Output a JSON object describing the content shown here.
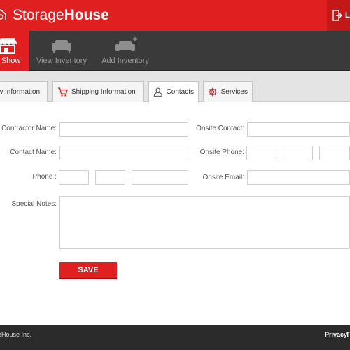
{
  "brand": {
    "name_light": "Storage",
    "name_bold": "House"
  },
  "header": {
    "logout_label": "Lo"
  },
  "nav": {
    "items": [
      {
        "label": "e Show",
        "icon": "storefront-icon",
        "active": true
      },
      {
        "label": "View Inventory",
        "icon": "sofa-icon",
        "active": false
      },
      {
        "label": "Add Inventory",
        "icon": "sofa-add-icon",
        "active": false
      }
    ]
  },
  "tabs": [
    {
      "label": "w Information",
      "active": false
    },
    {
      "label": "Shipping Information",
      "icon": "cart-icon",
      "active": false
    },
    {
      "label": "Contacts",
      "icon": "person-icon",
      "active": true
    },
    {
      "label": "Services",
      "icon": "gear-icon",
      "active": false
    }
  ],
  "form": {
    "contractor_name_label": "Contractor Name:",
    "contractor_name_value": "",
    "contact_name_label": "Contact Name:",
    "contact_name_value": "",
    "phone_label": "Phone :",
    "onsite_contact_label": "Onsite Contact:",
    "onsite_contact_value": "",
    "onsite_phone_label": "Onsite Phone:",
    "onsite_email_label": "Onsite Email:",
    "onsite_email_value": "",
    "special_notes_label": "Special Notes:",
    "special_notes_value": ""
  },
  "actions": {
    "save_label": "SAVE"
  },
  "footer": {
    "copyright": "eHouse Inc.",
    "privacy": "Privacy",
    "terms": "T"
  },
  "colors": {
    "accent": "#e02020",
    "nav_bg": "#3a3a3a",
    "footer_bg": "#2b2b2b"
  }
}
